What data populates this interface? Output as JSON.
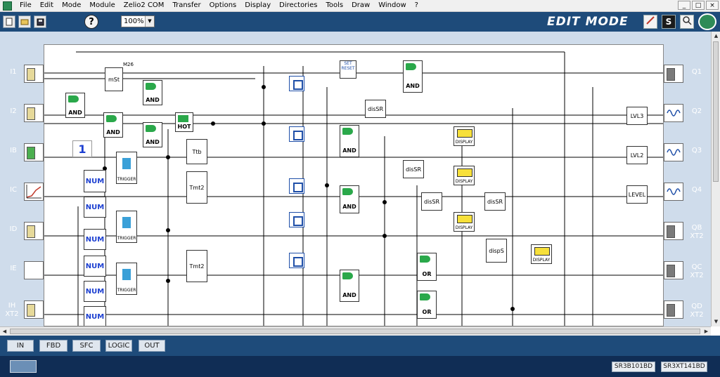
{
  "menu": {
    "items": [
      "File",
      "Edit",
      "Mode",
      "Module",
      "Zelio2 COM",
      "Transfer",
      "Options",
      "Display",
      "Directories",
      "Tools",
      "Draw",
      "Window",
      "?"
    ]
  },
  "window_buttons": {
    "minimize": "_",
    "restore": "□",
    "close": "×"
  },
  "toolbar": {
    "help_label": "?",
    "zoom_value": "100%",
    "mode_label": "EDIT MODE",
    "s_button": "S"
  },
  "inputs": [
    "I1",
    "I2",
    "IB",
    "IC",
    "ID",
    "IE",
    "IH\nXT2"
  ],
  "outputs": [
    "Q1",
    "Q2",
    "Q3",
    "Q4",
    "QB\nXT2",
    "QC\nXT2",
    "QD\nXT2"
  ],
  "blocks": {
    "m26": "M26",
    "mst": "mSt",
    "and": "AND",
    "hot": "HOT",
    "ttb": "Ttb",
    "tmt2": "Tmt2",
    "num": "NUM",
    "trigger": "TRIGGER",
    "dissr": "disSR",
    "display": "DISPLAY",
    "lvl3": "LVL3",
    "lvl2": "LVL2",
    "level": "LEVEL",
    "disps": "dispS",
    "or": "OR",
    "set_reset": "SET\nRESET",
    "one": "1"
  },
  "tabs": [
    "IN",
    "FBD",
    "SFC",
    "LOGIC",
    "OUT"
  ],
  "status": {
    "module_a": "SR3B101BD",
    "module_b": "SR3XT141BD"
  },
  "colors": {
    "toolbar_bg": "#1e4b7a",
    "status_bg": "#102d55",
    "gate_green": "#2aa84a",
    "wire": "#000000"
  }
}
